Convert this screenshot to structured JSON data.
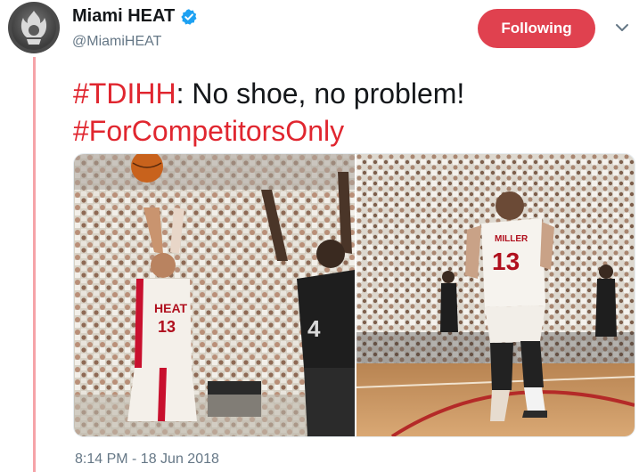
{
  "author": {
    "display_name": "Miami HEAT",
    "handle": "@MiamiHEAT",
    "verified_icon": "verified-badge-icon"
  },
  "follow": {
    "label": "Following"
  },
  "menu": {
    "icon": "chevron-down-icon"
  },
  "tweet": {
    "hashtag1": "#TDIHH",
    "text1": ": No shoe, no problem!",
    "hashtag2": "#ForCompetitorsOnly"
  },
  "media": {
    "photo_left_jersey": "13",
    "photo_left_opponent_jersey": "4",
    "photo_right_name": "MILLER",
    "photo_right_jersey": "13"
  },
  "timestamp": "8:14 PM - 18 Jun 2018",
  "colors": {
    "accent": "#e0414f",
    "hashtag": "#e0262f",
    "verified": "#1da1f2"
  }
}
